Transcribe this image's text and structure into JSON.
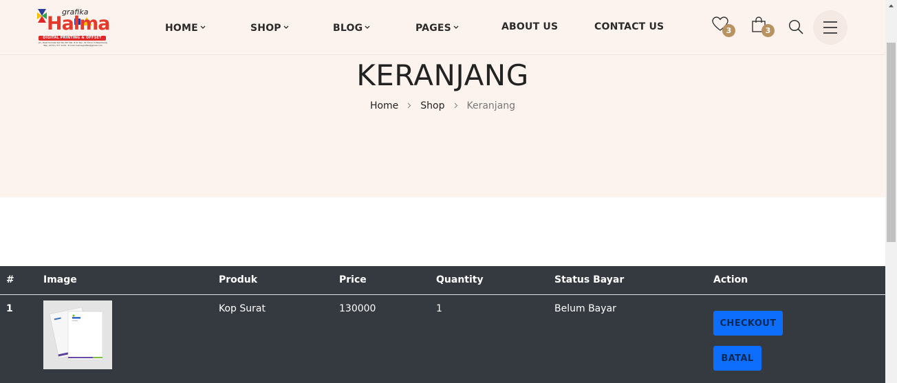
{
  "logo": {
    "top_word": "grafika",
    "main_word": "Halma",
    "band_text": "DIGITAL PRINTING & OFFSET",
    "small_line_1": "Jln. Dewi Kumala Sari No.307 Kel. 8 Ilir Kec. Ilir Timur II Palembang",
    "small_line_2": "Telp. (0711) 377 1134 · E-mail: halmagrafika@gmail.com"
  },
  "nav": {
    "items": [
      {
        "label": "HOME",
        "dropdown": true
      },
      {
        "label": "SHOP",
        "dropdown": true
      },
      {
        "label": "BLOG",
        "dropdown": true
      },
      {
        "label": "PAGES",
        "dropdown": true
      },
      {
        "label": "ABOUT US",
        "dropdown": false
      },
      {
        "label": "CONTACT US",
        "dropdown": false
      }
    ]
  },
  "header_icons": {
    "wishlist_icon": "heart-icon",
    "wishlist_count": "3",
    "cart_icon": "shopping-bag-icon",
    "cart_count": "3",
    "search_icon": "search-icon",
    "menu_icon": "hamburger-menu-icon"
  },
  "hero": {
    "title": "KERANJANG",
    "breadcrumb": [
      "Home",
      "Shop",
      "Keranjang"
    ]
  },
  "cart_table": {
    "columns": [
      "#",
      "Image",
      "Produk",
      "Price",
      "Quantity",
      "Status Bayar",
      "Action"
    ],
    "rows": [
      {
        "number": "1",
        "image": "kop-surat-letterhead-thumbnail",
        "product": "Kop Surat",
        "price": "130000",
        "quantity": "1",
        "status": "Belum Bayar",
        "actions": [
          "CHECKOUT",
          "BATAL"
        ]
      }
    ]
  },
  "colors": {
    "header_bg": "#fdf3ee",
    "badge": "#b99262",
    "table_bg": "#343a40",
    "button_primary": "#0d6efd"
  }
}
